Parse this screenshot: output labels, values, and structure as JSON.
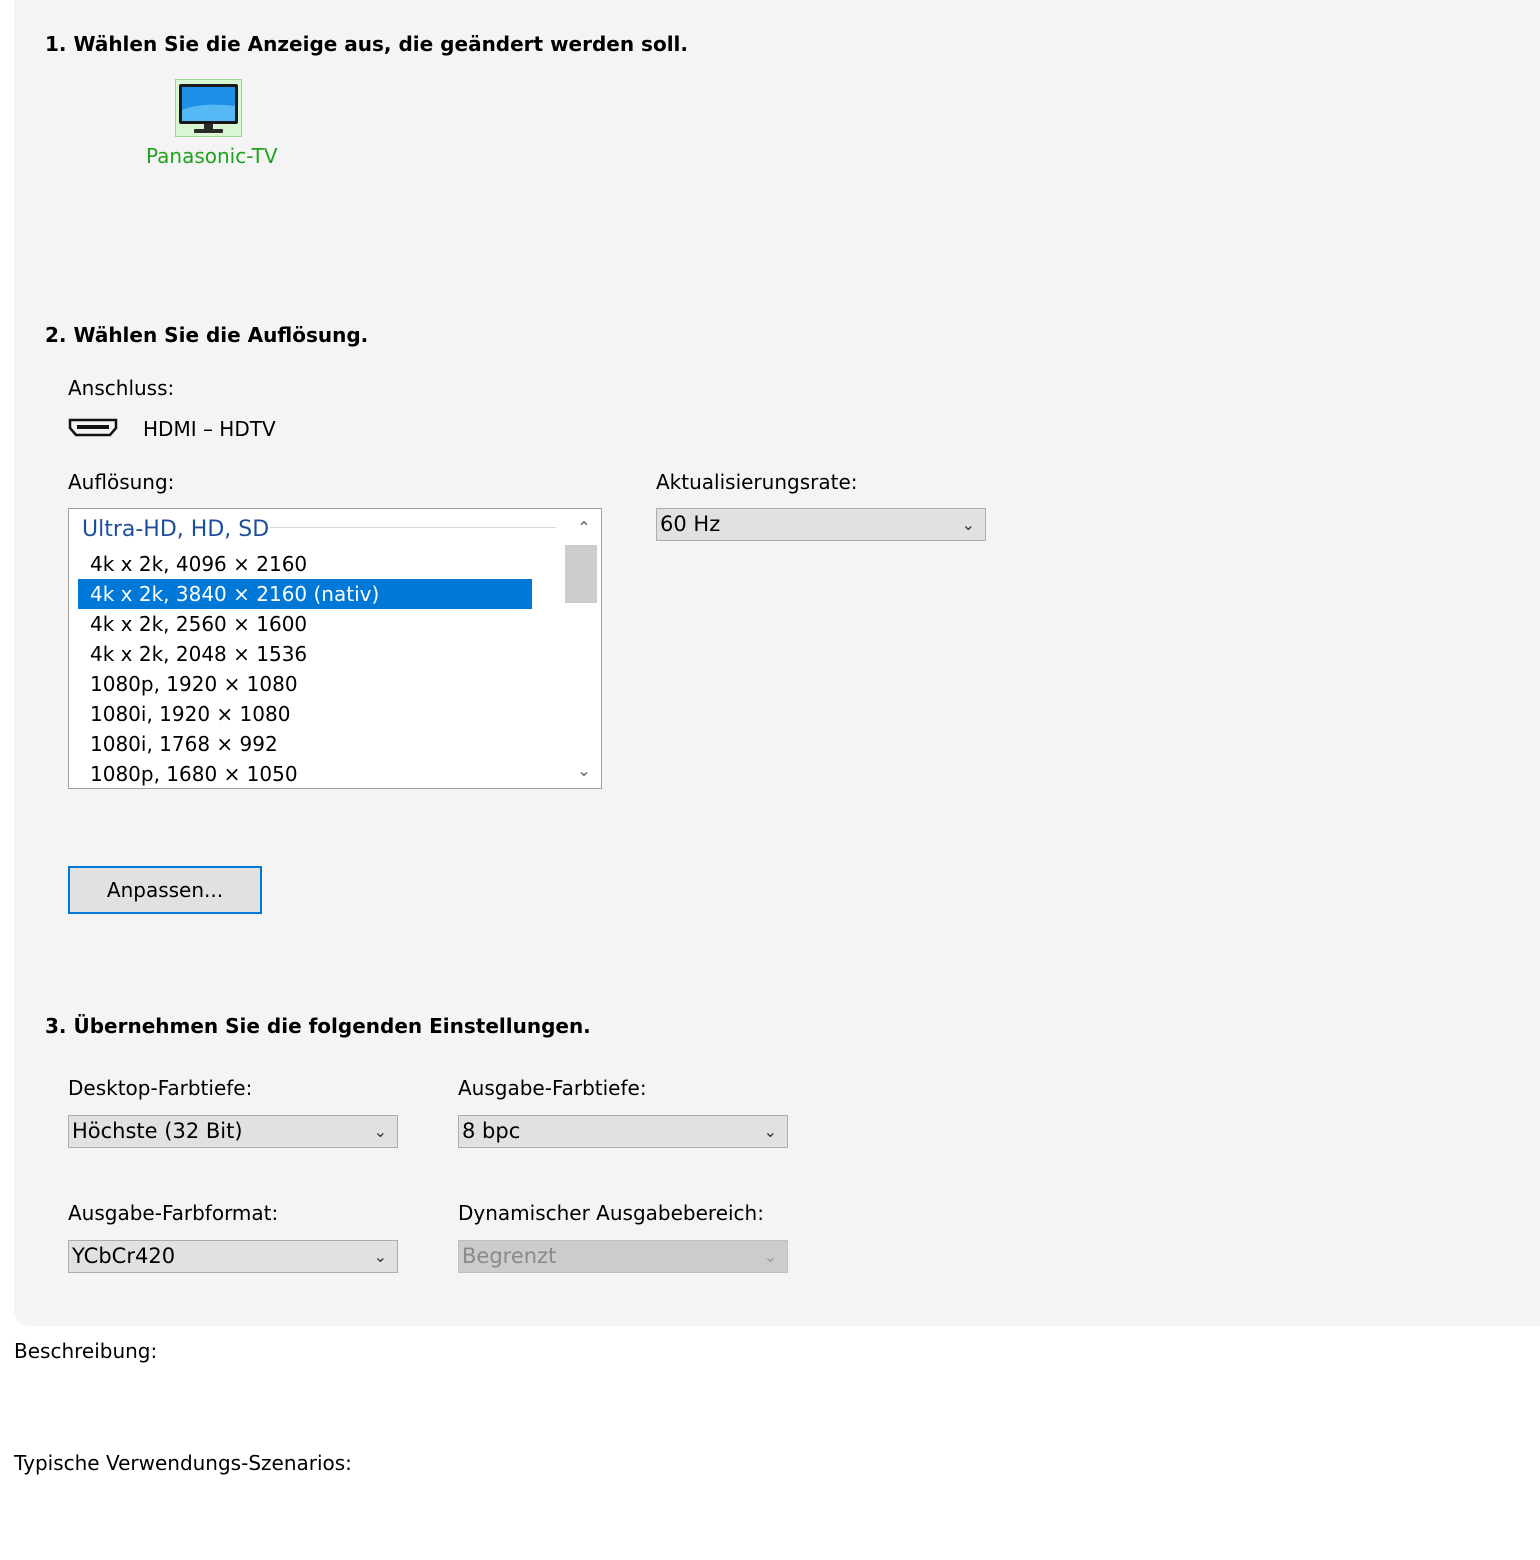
{
  "step1": {
    "heading": "1. Wählen Sie die Anzeige aus, die geändert werden soll.",
    "display_name": "Panasonic-TV"
  },
  "step2": {
    "heading": "2. Wählen Sie die Auflösung.",
    "connection_label": "Anschluss:",
    "connection_value": "HDMI – HDTV",
    "resolution_label": "Auflösung:",
    "refresh_label": "Aktualisierungsrate:",
    "refresh_value": "60 Hz",
    "group_title": "Ultra-HD, HD, SD",
    "resolutions": [
      "4k x 2k, 4096 × 2160",
      "4k x 2k, 3840 × 2160 (nativ)",
      "4k x 2k, 2560 × 1600",
      "4k x 2k, 2048 × 1536",
      "1080p, 1920 × 1080",
      "1080i, 1920 × 1080",
      "1080i, 1768 × 992",
      "1080p, 1680 × 1050"
    ],
    "selected_index": 1,
    "customize_button": "Anpassen..."
  },
  "step3": {
    "heading": "3. Übernehmen Sie die folgenden Einstellungen.",
    "desktop_depth_label": "Desktop-Farbtiefe:",
    "desktop_depth_value": "Höchste (32 Bit)",
    "output_depth_label": "Ausgabe-Farbtiefe:",
    "output_depth_value": "8 bpc",
    "color_format_label": "Ausgabe-Farbformat:",
    "color_format_value": "YCbCr420",
    "dynamic_range_label": "Dynamischer Ausgabebereich:",
    "dynamic_range_value": "Begrenzt"
  },
  "footer": {
    "description_label": "Beschreibung:",
    "usage_label": "Typische Verwendungs-Szenarios:"
  },
  "colors": {
    "selection": "#0078d7",
    "display_name": "#1fa31f",
    "group_title": "#1f4e9c"
  }
}
